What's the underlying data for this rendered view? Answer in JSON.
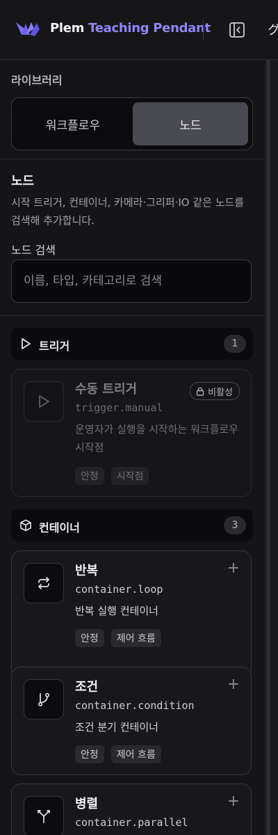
{
  "header": {
    "brand_primary": "Plem",
    "brand_secondary": "Teaching Pendant",
    "cut_text": "グ"
  },
  "sidebar": {
    "library_label": "라이브러리",
    "tabs": [
      {
        "label": "워크플로우",
        "selected": false
      },
      {
        "label": "노드",
        "selected": true
      }
    ],
    "node_section": {
      "title": "노드",
      "description": "시작 트리거, 컨테이너, 카메라·그리퍼·IO 같은 노드를 검색해 추가합니다.",
      "search_label": "노드 검색",
      "search_placeholder": "이름, 타입, 카테고리로 검색",
      "search_value": ""
    },
    "groups": [
      {
        "label": "트리거",
        "icon": "play-icon",
        "count": "1",
        "items": [
          {
            "name": "수동 트리거",
            "key": "trigger.manual",
            "description": "운영자가 실행을 시작하는 워크플로우 시작점",
            "tags": [
              "안정",
              "시작점"
            ],
            "icon": "play-icon",
            "status": "비활성",
            "disabled": true
          }
        ]
      },
      {
        "label": "컨테이너",
        "icon": "cube-icon",
        "count": "3",
        "items": [
          {
            "name": "반복",
            "key": "container.loop",
            "description": "반복 실행 컨테이너",
            "tags": [
              "안정",
              "제어 흐름"
            ],
            "icon": "repeat-icon",
            "disabled": false
          },
          {
            "name": "조건",
            "key": "container.condition",
            "description": "조건 분기 컨테이너",
            "tags": [
              "안정",
              "제어 흐름"
            ],
            "icon": "branch-icon",
            "disabled": false
          },
          {
            "name": "병렬",
            "key": "container.parallel",
            "description": "",
            "tags": [],
            "icon": "split-icon",
            "disabled": false
          }
        ]
      }
    ],
    "add_glyph": "+"
  },
  "colors": {
    "accent": "#8f86f5",
    "background": "#141416",
    "selected_tab": "#4a4a52"
  }
}
